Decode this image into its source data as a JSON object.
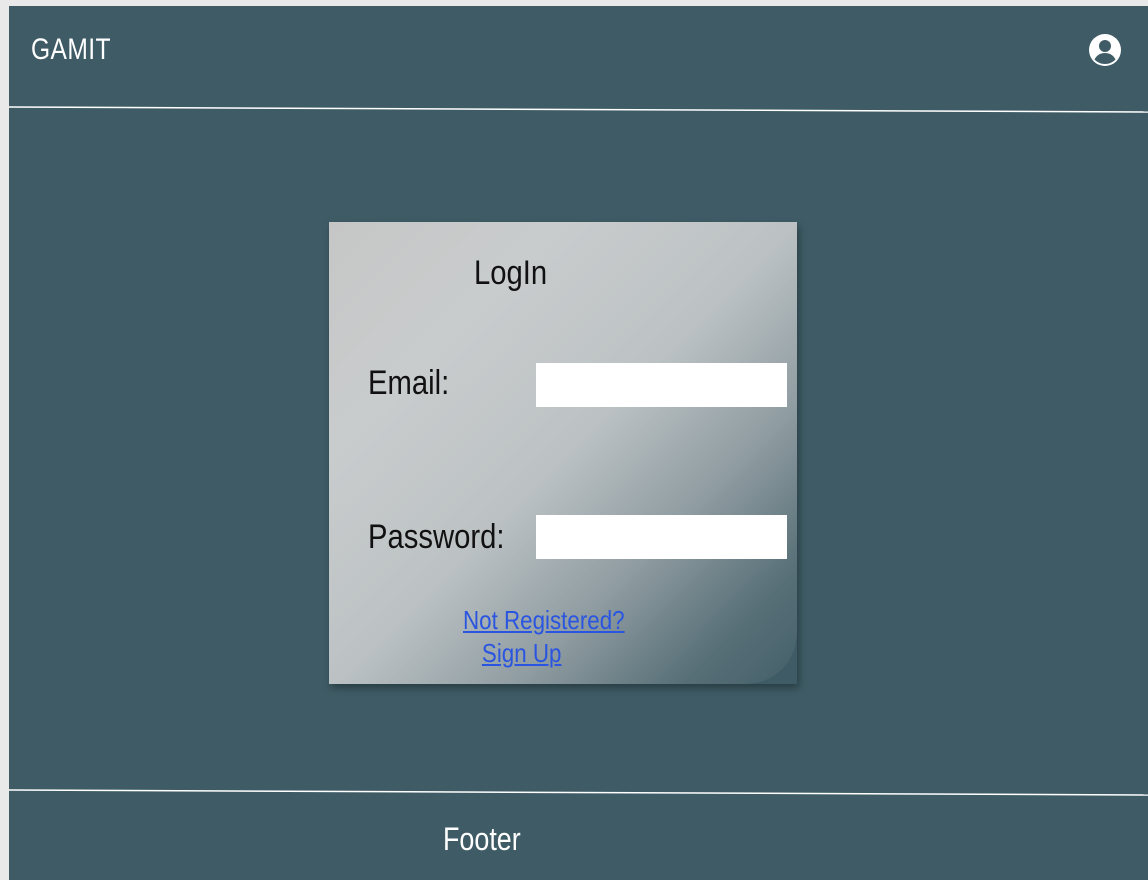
{
  "header": {
    "brand": "GAMIT",
    "user_icon": "user-circle-icon"
  },
  "login": {
    "title": "LogIn",
    "email_label": "Email:",
    "email_value": "",
    "password_label": "Password:",
    "password_value": "",
    "not_registered_link": "Not Registered?",
    "sign_up_link": "Sign Up"
  },
  "footer": {
    "text": "Footer"
  },
  "colors": {
    "background": "#3f5c66",
    "link": "#2a55e0",
    "divider": "#ffffff"
  }
}
